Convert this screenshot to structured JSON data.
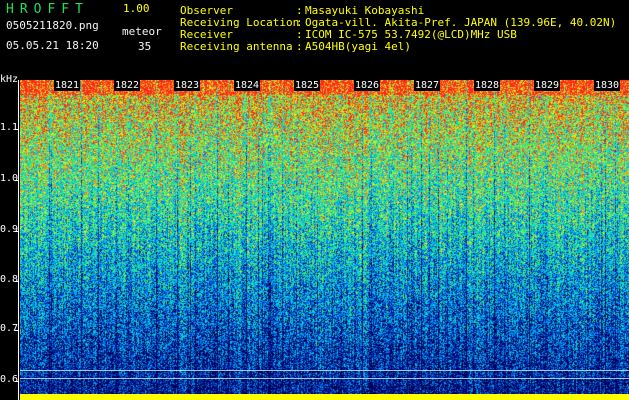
{
  "header": {
    "app_name": "HROFFT",
    "version": "1.00",
    "filename": "0505211820.png",
    "datetime": "05.05.21 18:20",
    "mode": "meteor",
    "count": "35"
  },
  "info": [
    {
      "label": "Observer",
      "value": "Masayuki Kobayashi"
    },
    {
      "label": "Receiving Location",
      "value": "Ogata-vill. Akita-Pref. JAPAN (139.96E, 40.02N)"
    },
    {
      "label": "Receiver",
      "value": "ICOM IC-575 53.7492(@LCD)MHz USB"
    },
    {
      "label": "Receiving antenna",
      "value": "A504HB(yagi 4el)"
    }
  ],
  "separator": ":",
  "axis": {
    "unit": "kHz",
    "freq_ticks": [
      "1.1",
      "1.0",
      "0.9",
      "0.8",
      "0.7",
      "0.6"
    ],
    "time_ticks": [
      "1821",
      "1822",
      "1823",
      "1824",
      "1825",
      "1826",
      "1827",
      "1828",
      "1829",
      "1830"
    ]
  },
  "colors": {
    "header_green": "#1ee05a",
    "text_white": "#f4f4f4",
    "count_yellow": "#ffff00"
  }
}
